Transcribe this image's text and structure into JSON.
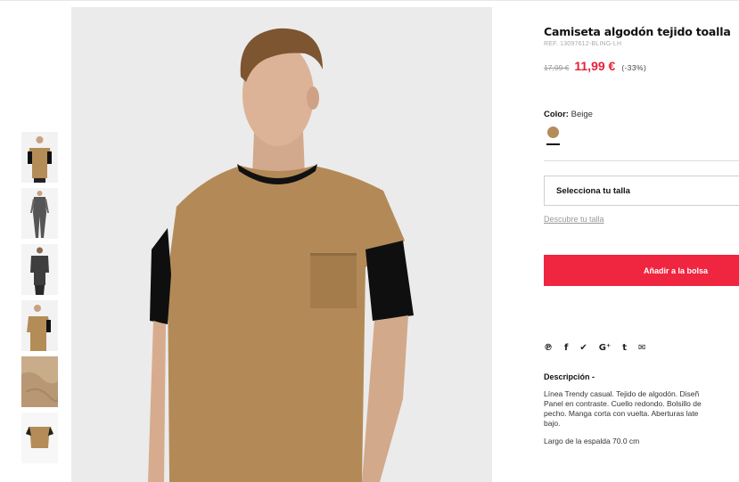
{
  "product": {
    "title": "Camiseta algodón tejido toalla",
    "ref": "REF. 13097612-BLING-LH",
    "price_old": "17,99 €",
    "price_new": "11,99 €",
    "discount": "(-33%)"
  },
  "color": {
    "label": "Color:",
    "value": "Beige",
    "swatch_hex": "#b48c58"
  },
  "size": {
    "select_label": "Selecciona tu talla",
    "discover_link": "Descubre tu talla"
  },
  "cart": {
    "add_label": "Añadir a la bolsa"
  },
  "social": {
    "icons": [
      "pinterest-icon",
      "facebook-icon",
      "twitter-icon",
      "google-plus-icon",
      "tumblr-icon",
      "email-icon"
    ],
    "glyphs": [
      "⚲",
      "f",
      "🐦",
      "G+",
      "t",
      "✉"
    ]
  },
  "description": {
    "title": "Descripción -",
    "lines": [
      "Línea Trendy casual. Tejido de algodón. Diseñ",
      "Panel en contraste. Cuello redondo. Bolsillo de",
      "pecho. Manga corta con vuelta. Aberturas late",
      "bajo."
    ],
    "extra": "Largo de la espalda 70.0 cm"
  },
  "colors": {
    "accent": "#f0253f",
    "price_red": "#e8203a",
    "shirt_tan": "#b48c58",
    "sleeve_black": "#111111"
  }
}
